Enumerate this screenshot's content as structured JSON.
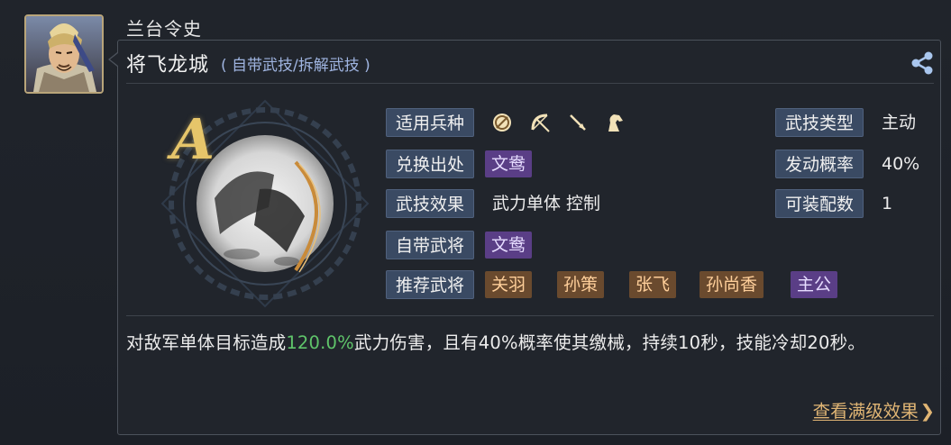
{
  "poster": {
    "name": "兰台令史"
  },
  "skill": {
    "name": "将飞龙城",
    "type_label": "( 自带武技/拆解武技 )",
    "grade": "A"
  },
  "attributes": {
    "troop": {
      "label": "适用兵种",
      "icons": [
        "shield-icon",
        "bow-icon",
        "spear-icon",
        "horse-icon"
      ]
    },
    "source": {
      "label": "兑换出处",
      "value": "文鸯"
    },
    "effect": {
      "label": "武技效果",
      "value": "武力单体 控制"
    },
    "own_general": {
      "label": "自带武将",
      "value": "文鸯"
    },
    "recommend": {
      "label": "推荐武将",
      "values": [
        "关羽",
        "孙策",
        "张飞",
        "孙尚香",
        "主公"
      ]
    },
    "skill_kind": {
      "label": "武技类型",
      "value": "主动"
    },
    "trigger_rate": {
      "label": "发动概率",
      "value": "40%"
    },
    "equippable": {
      "label": "可装配数",
      "value": "1"
    }
  },
  "description": {
    "before": "对敌军单体目标造成",
    "highlight": "120.0%",
    "after": "武力伤害，且有40%概率使其缴械，持续10秒，技能冷却20秒。"
  },
  "more_link": {
    "label": "查看满级效果",
    "chevron": "❯"
  },
  "colors": {
    "highlight": "#5fc46a",
    "link": "#e0b574",
    "tag_purple": "#5a3e86",
    "tag_orange": "#6a4a2e",
    "label_bg": "#3a4a63"
  }
}
